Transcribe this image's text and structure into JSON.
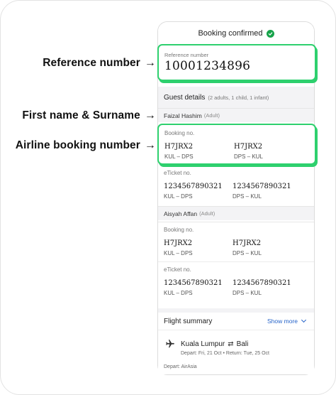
{
  "annotations": {
    "reference": "Reference number",
    "name": "First name & Surname",
    "airline": "Airline booking number",
    "arrow": "→"
  },
  "header": {
    "title": "Booking confirmed"
  },
  "reference": {
    "label": "Reference number",
    "value": "10001234896"
  },
  "guest_details": {
    "title": "Guest details",
    "summary": "(2 adults, 1 child, 1 infant)"
  },
  "passengers": [
    {
      "name": "Faizal Hashim",
      "type": "(Adult)",
      "booking_label": "Booking no.",
      "bookings": [
        {
          "code": "H7JRX2",
          "route": "KUL – DPS"
        },
        {
          "code": "H7JRX2",
          "route": "DPS – KUL"
        }
      ],
      "eticket_label": "eTicket no.",
      "etickets": [
        {
          "code": "1234567890321",
          "route": "KUL – DPS"
        },
        {
          "code": "1234567890321",
          "route": "DPS – KUL"
        }
      ]
    },
    {
      "name": "Aisyah Affan",
      "type": "(Adult)",
      "booking_label": "Booking no.",
      "bookings": [
        {
          "code": "H7JRX2",
          "route": "KUL – DPS"
        },
        {
          "code": "H7JRX2",
          "route": "DPS – KUL"
        }
      ],
      "eticket_label": "eTicket no.",
      "etickets": [
        {
          "code": "1234567890321",
          "route": "KUL – DPS"
        },
        {
          "code": "1234567890321",
          "route": "DPS – KUL"
        }
      ]
    }
  ],
  "flight_summary": {
    "title": "Flight summary",
    "show_more": "Show more",
    "origin": "Kuala Lumpur",
    "destination": "Bali",
    "dates": "Depart: Fri, 21 Oct  •  Return: Tue, 25 Oct",
    "airline": "Depart: AirAsia"
  },
  "colors": {
    "highlight": "#2ed06e",
    "check": "#17a34a",
    "link": "#2563c9"
  }
}
